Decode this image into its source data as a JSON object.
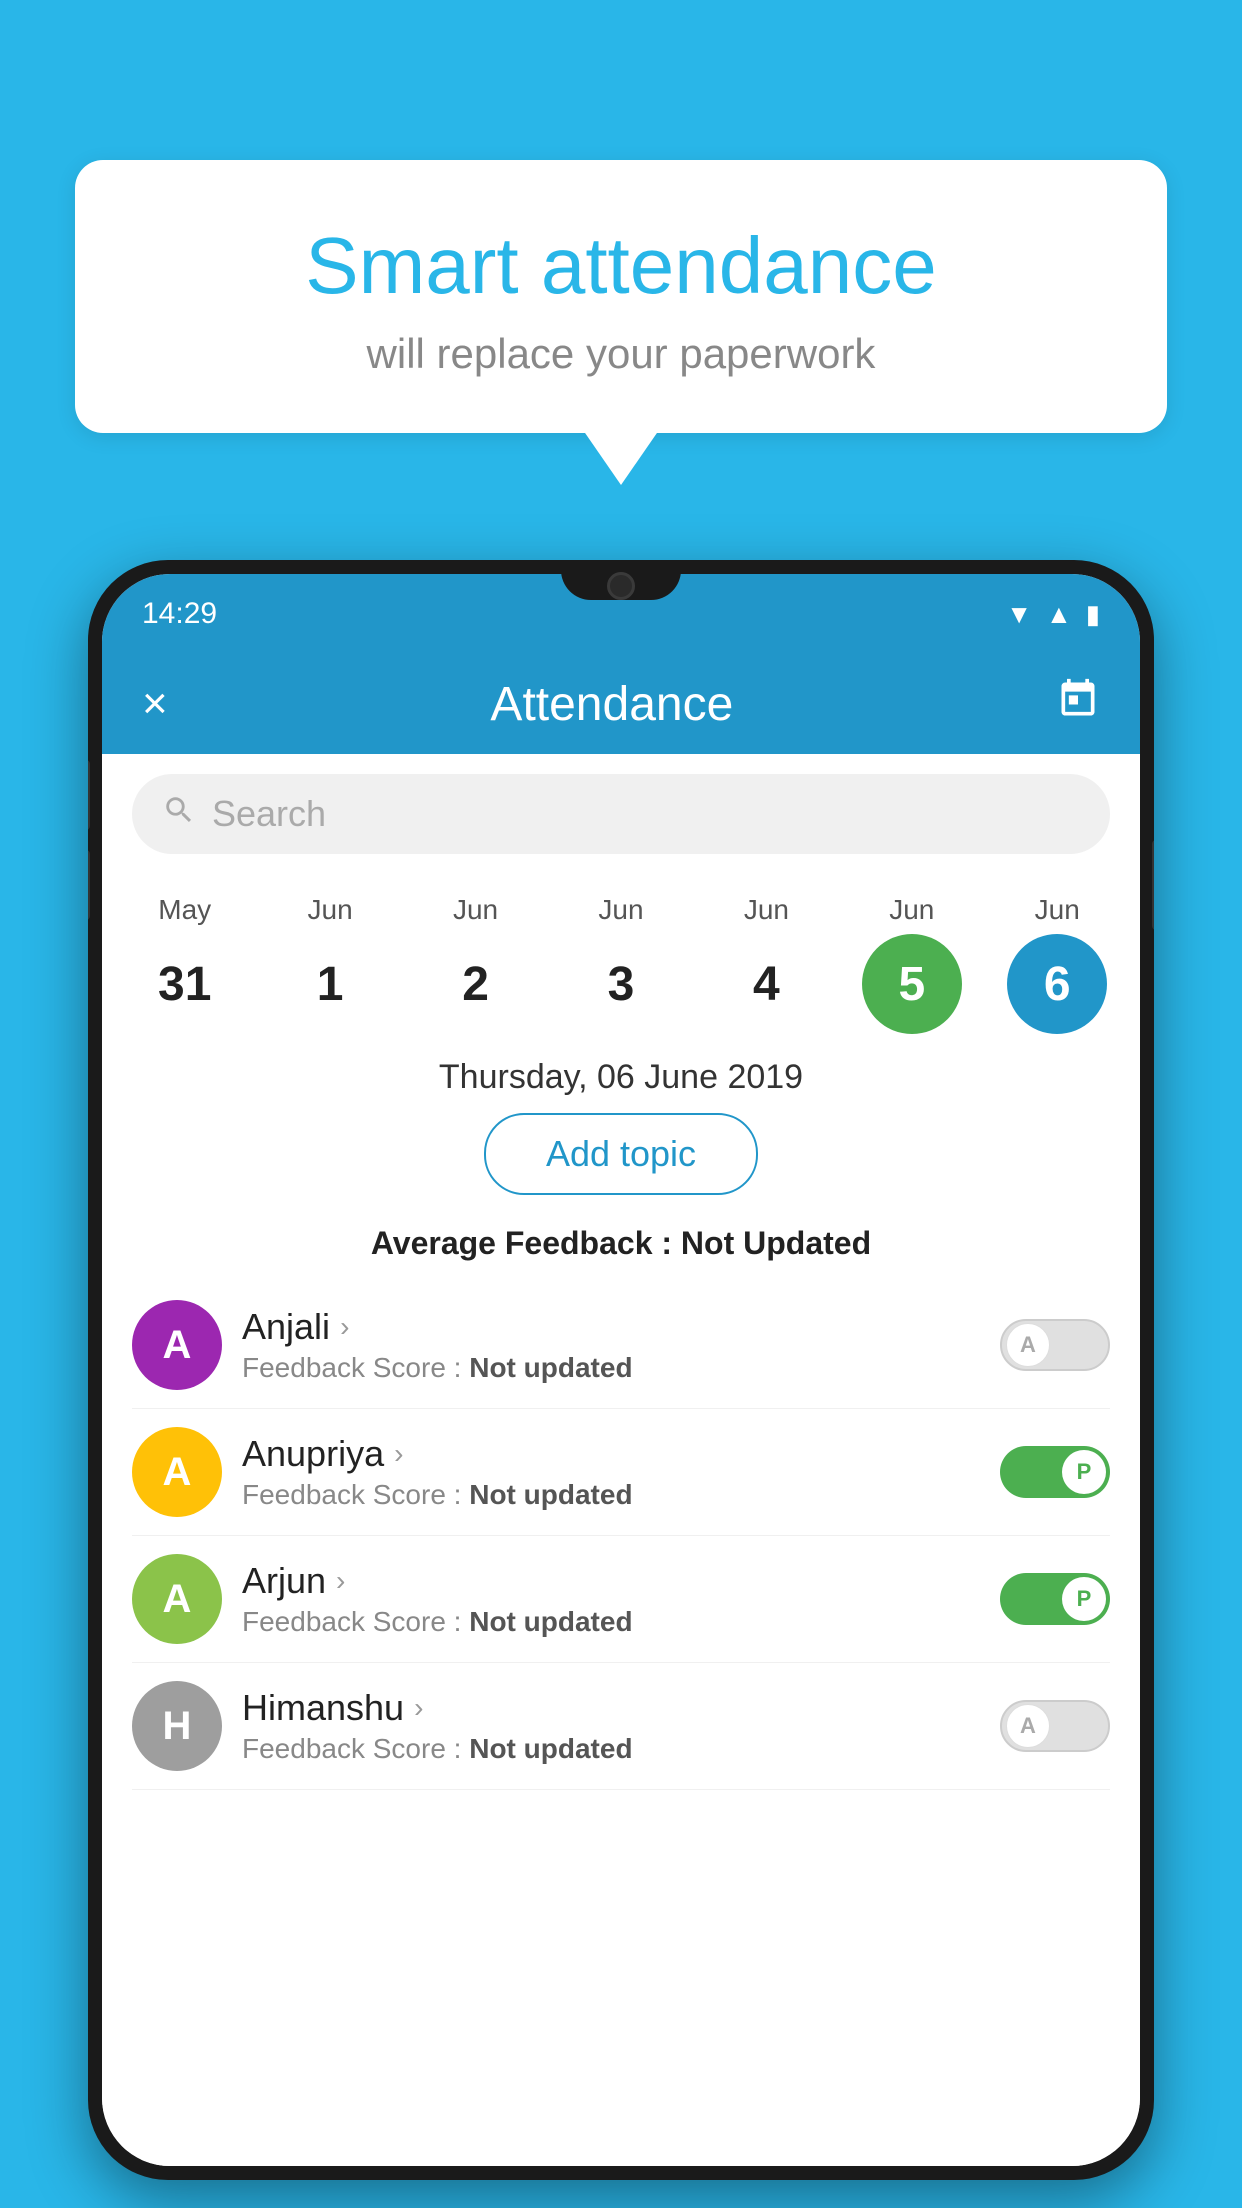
{
  "background_color": "#29b6e8",
  "speech_bubble": {
    "title": "Smart attendance",
    "subtitle": "will replace your paperwork"
  },
  "status_bar": {
    "time": "14:29",
    "icons": [
      "wifi",
      "signal",
      "battery"
    ]
  },
  "app_header": {
    "title": "Attendance",
    "close_label": "×",
    "calendar_icon": "📅"
  },
  "search": {
    "placeholder": "Search"
  },
  "calendar": {
    "days": [
      {
        "month": "May",
        "num": "31",
        "state": "normal"
      },
      {
        "month": "Jun",
        "num": "1",
        "state": "normal"
      },
      {
        "month": "Jun",
        "num": "2",
        "state": "normal"
      },
      {
        "month": "Jun",
        "num": "3",
        "state": "normal"
      },
      {
        "month": "Jun",
        "num": "4",
        "state": "normal"
      },
      {
        "month": "Jun",
        "num": "5",
        "state": "today"
      },
      {
        "month": "Jun",
        "num": "6",
        "state": "selected"
      }
    ]
  },
  "selected_date_label": "Thursday, 06 June 2019",
  "add_topic_label": "Add topic",
  "avg_feedback_prefix": "Average Feedback : ",
  "avg_feedback_value": "Not Updated",
  "students": [
    {
      "name": "Anjali",
      "avatar_letter": "A",
      "avatar_color": "#9c27b0",
      "feedback_label": "Feedback Score : ",
      "feedback_value": "Not updated",
      "toggle": "off",
      "toggle_letter": "A"
    },
    {
      "name": "Anupriya",
      "avatar_letter": "A",
      "avatar_color": "#ffc107",
      "feedback_label": "Feedback Score : ",
      "feedback_value": "Not updated",
      "toggle": "on",
      "toggle_letter": "P"
    },
    {
      "name": "Arjun",
      "avatar_letter": "A",
      "avatar_color": "#8bc34a",
      "feedback_label": "Feedback Score : ",
      "feedback_value": "Not updated",
      "toggle": "on",
      "toggle_letter": "P"
    },
    {
      "name": "Himanshu",
      "avatar_letter": "H",
      "avatar_color": "#9e9e9e",
      "feedback_label": "Feedback Score : ",
      "feedback_value": "Not updated",
      "toggle": "off",
      "toggle_letter": "A"
    }
  ]
}
